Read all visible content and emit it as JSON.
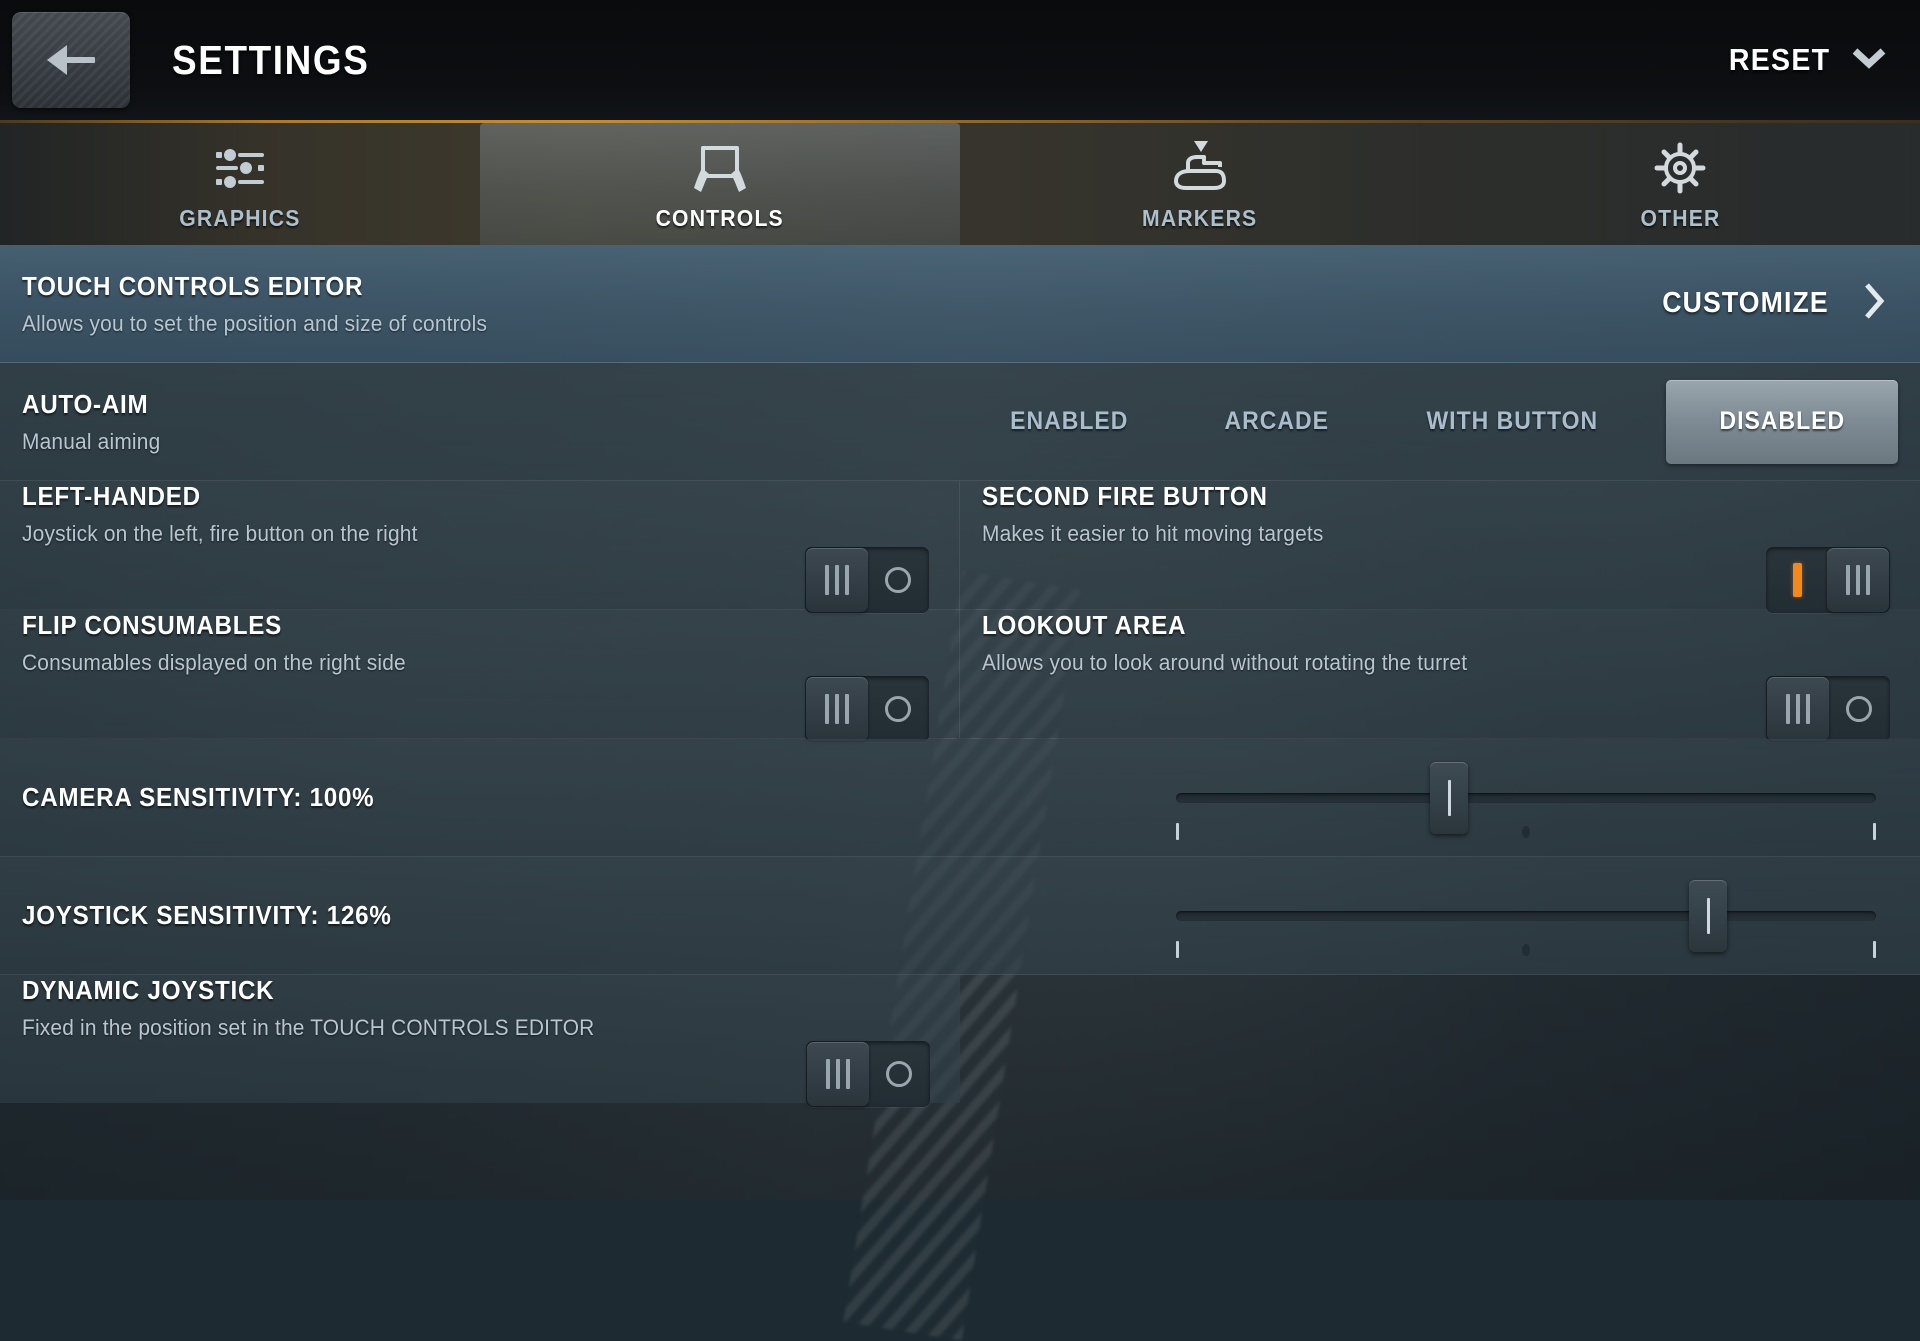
{
  "header": {
    "back_icon": "arrow-left-icon",
    "title": "SETTINGS",
    "reset_label": "RESET",
    "reset_icon": "chevron-down-icon"
  },
  "tabs": [
    {
      "label": "GRAPHICS",
      "icon": "sliders-icon",
      "active": false
    },
    {
      "label": "CONTROLS",
      "icon": "touchscreen-icon",
      "active": true
    },
    {
      "label": "MARKERS",
      "icon": "tank-marker-icon",
      "active": false
    },
    {
      "label": "OTHER",
      "icon": "gear-icon",
      "active": false
    }
  ],
  "settings": {
    "touch_controls_editor": {
      "title": "TOUCH CONTROLS EDITOR",
      "subtitle": "Allows you to set the position and size of controls",
      "action_label": "CUSTOMIZE",
      "action_icon": "chevron-right-icon"
    },
    "auto_aim": {
      "title": "AUTO-AIM",
      "subtitle": "Manual aiming",
      "options": [
        "ENABLED",
        "ARCADE",
        "WITH BUTTON",
        "DISABLED"
      ],
      "selected": "DISABLED"
    },
    "left_handed": {
      "title": "LEFT-HANDED",
      "subtitle": "Joystick on the left, fire button on the right",
      "state": "off"
    },
    "second_fire_button": {
      "title": "SECOND FIRE BUTTON",
      "subtitle": "Makes it easier to hit moving targets",
      "state": "on"
    },
    "flip_consumables": {
      "title": "FLIP CONSUMABLES",
      "subtitle": "Consumables displayed on the right side",
      "state": "off"
    },
    "lookout_area": {
      "title": "LOOKOUT AREA",
      "subtitle": "Allows you to look around without rotating the turret",
      "state": "off"
    },
    "camera_sensitivity": {
      "title": "CAMERA SENSITIVITY: 100%",
      "value": 100,
      "percent_position": 39
    },
    "joystick_sensitivity": {
      "title": "JOYSTICK SENSITIVITY: 126%",
      "value": 126,
      "percent_position": 76
    },
    "dynamic_joystick": {
      "title": "DYNAMIC JOYSTICK",
      "subtitle": "Fixed in the position set in the TOUCH CONTROLS EDITOR",
      "state": "off"
    }
  },
  "colors": {
    "accent_orange": "#f08a1e",
    "selected_segment": "#859199",
    "banner_blue": "#51748e",
    "text_primary": "#ffffff",
    "text_secondary": "#b9c6d1"
  }
}
